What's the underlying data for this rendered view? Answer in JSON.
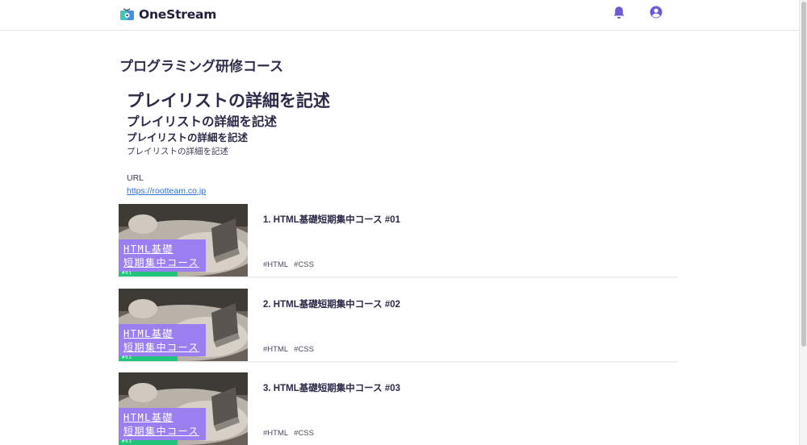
{
  "header": {
    "brand": "OneStream",
    "bell_icon": "bell-icon",
    "user_icon": "user-circle-icon",
    "accent": "#6a5ad6"
  },
  "page": {
    "course_title": "プログラミング研修コース",
    "heading1": "プレイリストの詳細を記述",
    "heading2": "プレイリストの詳細を記述",
    "heading3": "プレイリストの詳細を記述",
    "paragraph": "プレイリストの詳細を記述",
    "url_label": "URL",
    "url": "https://rootteam.co.jp"
  },
  "cards": [
    {
      "title": "1. HTML基礎短期集中コース #01",
      "thumb_line1": "HTML基礎",
      "thumb_line2": "短期集中コース",
      "thumb_num": "#01",
      "tags": [
        "#HTML",
        "#CSS"
      ]
    },
    {
      "title": "2. HTML基礎短期集中コース #02",
      "thumb_line1": "HTML基礎",
      "thumb_line2": "短期集中コース",
      "thumb_num": "#02",
      "tags": [
        "#HTML",
        "#CSS"
      ]
    },
    {
      "title": "3. HTML基礎短期集中コース #03",
      "thumb_line1": "HTML基礎",
      "thumb_line2": "短期集中コース",
      "thumb_num": "#03",
      "tags": [
        "#HTML",
        "#CSS"
      ]
    }
  ],
  "colors": {
    "thumb_label_bg": "#9b7ff0",
    "thumb_bar": "#22c37a"
  }
}
